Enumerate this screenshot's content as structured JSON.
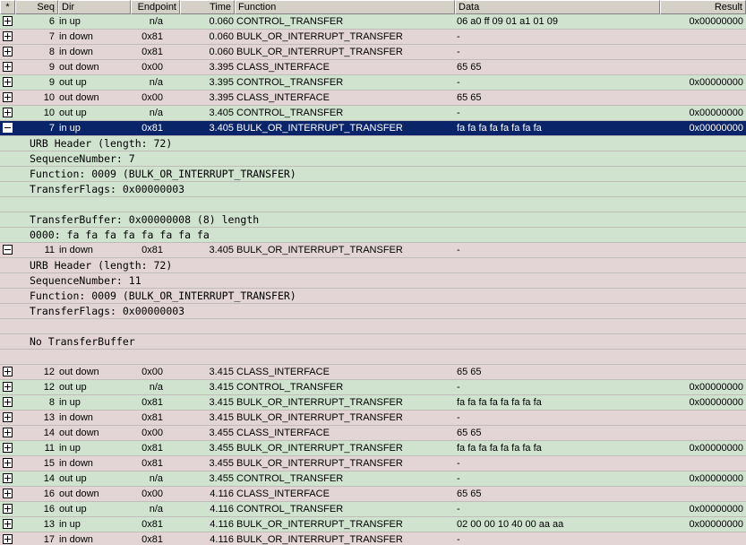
{
  "columns": {
    "star": "*",
    "seq": "Seq",
    "dir": "Dir",
    "endpoint": "Endpoint",
    "time": "Time",
    "function": "Function",
    "data": "Data",
    "result": "Result"
  },
  "rows": [
    {
      "kind": "record",
      "color": "green",
      "expand": "plus",
      "seq": "6",
      "dir": "in up",
      "endpoint": "n/a",
      "time": "0.060",
      "function": "CONTROL_TRANSFER",
      "data": "06 a0 ff 09 01 a1 01 09",
      "result": "0x00000000"
    },
    {
      "kind": "record",
      "color": "pink",
      "expand": "plus",
      "seq": "7",
      "dir": "in down",
      "endpoint": "0x81",
      "time": "0.060",
      "function": "BULK_OR_INTERRUPT_TRANSFER",
      "data": "-",
      "result": ""
    },
    {
      "kind": "record",
      "color": "pink",
      "expand": "plus",
      "seq": "8",
      "dir": "in down",
      "endpoint": "0x81",
      "time": "0.060",
      "function": "BULK_OR_INTERRUPT_TRANSFER",
      "data": "-",
      "result": ""
    },
    {
      "kind": "record",
      "color": "pink",
      "expand": "plus",
      "seq": "9",
      "dir": "out down",
      "endpoint": "0x00",
      "time": "3.395",
      "function": "CLASS_INTERFACE",
      "data": "65 65",
      "result": ""
    },
    {
      "kind": "record",
      "color": "green",
      "expand": "plus",
      "seq": "9",
      "dir": "out up",
      "endpoint": "n/a",
      "time": "3.395",
      "function": "CONTROL_TRANSFER",
      "data": "-",
      "result": "0x00000000"
    },
    {
      "kind": "record",
      "color": "pink",
      "expand": "plus",
      "seq": "10",
      "dir": "out down",
      "endpoint": "0x00",
      "time": "3.395",
      "function": "CLASS_INTERFACE",
      "data": "65 65",
      "result": ""
    },
    {
      "kind": "record",
      "color": "green",
      "expand": "plus",
      "seq": "10",
      "dir": "out up",
      "endpoint": "n/a",
      "time": "3.405",
      "function": "CONTROL_TRANSFER",
      "data": "-",
      "result": "0x00000000"
    },
    {
      "kind": "record",
      "color": "sel",
      "expand": "minus",
      "seq": "7",
      "dir": "in up",
      "endpoint": "0x81",
      "time": "3.405",
      "function": "BULK_OR_INTERRUPT_TRANSFER",
      "data": "fa fa fa fa fa fa fa fa",
      "result": "0x00000000"
    },
    {
      "kind": "detail",
      "color": "green",
      "text": "URB Header (length: 72)"
    },
    {
      "kind": "detail",
      "color": "green",
      "text": "SequenceNumber: 7"
    },
    {
      "kind": "detail",
      "color": "green",
      "text": "Function: 0009 (BULK_OR_INTERRUPT_TRANSFER)"
    },
    {
      "kind": "detail",
      "color": "green",
      "text": "TransferFlags: 0x00000003"
    },
    {
      "kind": "detail",
      "color": "green",
      "text": ""
    },
    {
      "kind": "detail",
      "color": "green",
      "text": "TransferBuffer: 0x00000008 (8) length"
    },
    {
      "kind": "detail",
      "color": "green",
      "text": "0000: fa fa fa fa fa fa fa fa"
    },
    {
      "kind": "record",
      "color": "pink",
      "expand": "minus",
      "seq": "11",
      "dir": "in down",
      "endpoint": "0x81",
      "time": "3.405",
      "function": "BULK_OR_INTERRUPT_TRANSFER",
      "data": "-",
      "result": ""
    },
    {
      "kind": "detail",
      "color": "pink",
      "text": "URB Header (length: 72)"
    },
    {
      "kind": "detail",
      "color": "pink",
      "text": "SequenceNumber: 11"
    },
    {
      "kind": "detail",
      "color": "pink",
      "text": "Function: 0009 (BULK_OR_INTERRUPT_TRANSFER)"
    },
    {
      "kind": "detail",
      "color": "pink",
      "text": "TransferFlags: 0x00000003"
    },
    {
      "kind": "detail",
      "color": "pink",
      "text": ""
    },
    {
      "kind": "detail",
      "color": "pink",
      "text": "No TransferBuffer"
    },
    {
      "kind": "detail",
      "color": "pink",
      "text": ""
    },
    {
      "kind": "record",
      "color": "pink",
      "expand": "plus",
      "seq": "12",
      "dir": "out down",
      "endpoint": "0x00",
      "time": "3.415",
      "function": "CLASS_INTERFACE",
      "data": "65 65",
      "result": ""
    },
    {
      "kind": "record",
      "color": "green",
      "expand": "plus",
      "seq": "12",
      "dir": "out up",
      "endpoint": "n/a",
      "time": "3.415",
      "function": "CONTROL_TRANSFER",
      "data": "-",
      "result": "0x00000000"
    },
    {
      "kind": "record",
      "color": "green",
      "expand": "plus",
      "seq": "8",
      "dir": "in up",
      "endpoint": "0x81",
      "time": "3.415",
      "function": "BULK_OR_INTERRUPT_TRANSFER",
      "data": "fa fa fa fa fa fa fa fa",
      "result": "0x00000000"
    },
    {
      "kind": "record",
      "color": "pink",
      "expand": "plus",
      "seq": "13",
      "dir": "in down",
      "endpoint": "0x81",
      "time": "3.415",
      "function": "BULK_OR_INTERRUPT_TRANSFER",
      "data": "-",
      "result": ""
    },
    {
      "kind": "record",
      "color": "pink",
      "expand": "plus",
      "seq": "14",
      "dir": "out down",
      "endpoint": "0x00",
      "time": "3.455",
      "function": "CLASS_INTERFACE",
      "data": "65 65",
      "result": ""
    },
    {
      "kind": "record",
      "color": "green",
      "expand": "plus",
      "seq": "11",
      "dir": "in up",
      "endpoint": "0x81",
      "time": "3.455",
      "function": "BULK_OR_INTERRUPT_TRANSFER",
      "data": "fa fa fa fa fa fa fa fa",
      "result": "0x00000000"
    },
    {
      "kind": "record",
      "color": "pink",
      "expand": "plus",
      "seq": "15",
      "dir": "in down",
      "endpoint": "0x81",
      "time": "3.455",
      "function": "BULK_OR_INTERRUPT_TRANSFER",
      "data": "-",
      "result": ""
    },
    {
      "kind": "record",
      "color": "green",
      "expand": "plus",
      "seq": "14",
      "dir": "out up",
      "endpoint": "n/a",
      "time": "3.455",
      "function": "CONTROL_TRANSFER",
      "data": "-",
      "result": "0x00000000"
    },
    {
      "kind": "record",
      "color": "pink",
      "expand": "plus",
      "seq": "16",
      "dir": "out down",
      "endpoint": "0x00",
      "time": "4.116",
      "function": "CLASS_INTERFACE",
      "data": "65 65",
      "result": ""
    },
    {
      "kind": "record",
      "color": "green",
      "expand": "plus",
      "seq": "16",
      "dir": "out up",
      "endpoint": "n/a",
      "time": "4.116",
      "function": "CONTROL_TRANSFER",
      "data": "-",
      "result": "0x00000000"
    },
    {
      "kind": "record",
      "color": "green",
      "expand": "plus",
      "seq": "13",
      "dir": "in up",
      "endpoint": "0x81",
      "time": "4.116",
      "function": "BULK_OR_INTERRUPT_TRANSFER",
      "data": "02 00 00 10 40 00 aa aa",
      "result": "0x00000000"
    },
    {
      "kind": "record",
      "color": "pink",
      "expand": "plus",
      "seq": "17",
      "dir": "in down",
      "endpoint": "0x81",
      "time": "4.116",
      "function": "BULK_OR_INTERRUPT_TRANSFER",
      "data": "-",
      "result": ""
    }
  ],
  "colors": {
    "green_row": "#cfe3cf",
    "pink_row": "#e3d5d5",
    "selected_row": "#0a246a",
    "header_bg": "#d4d0c8"
  }
}
